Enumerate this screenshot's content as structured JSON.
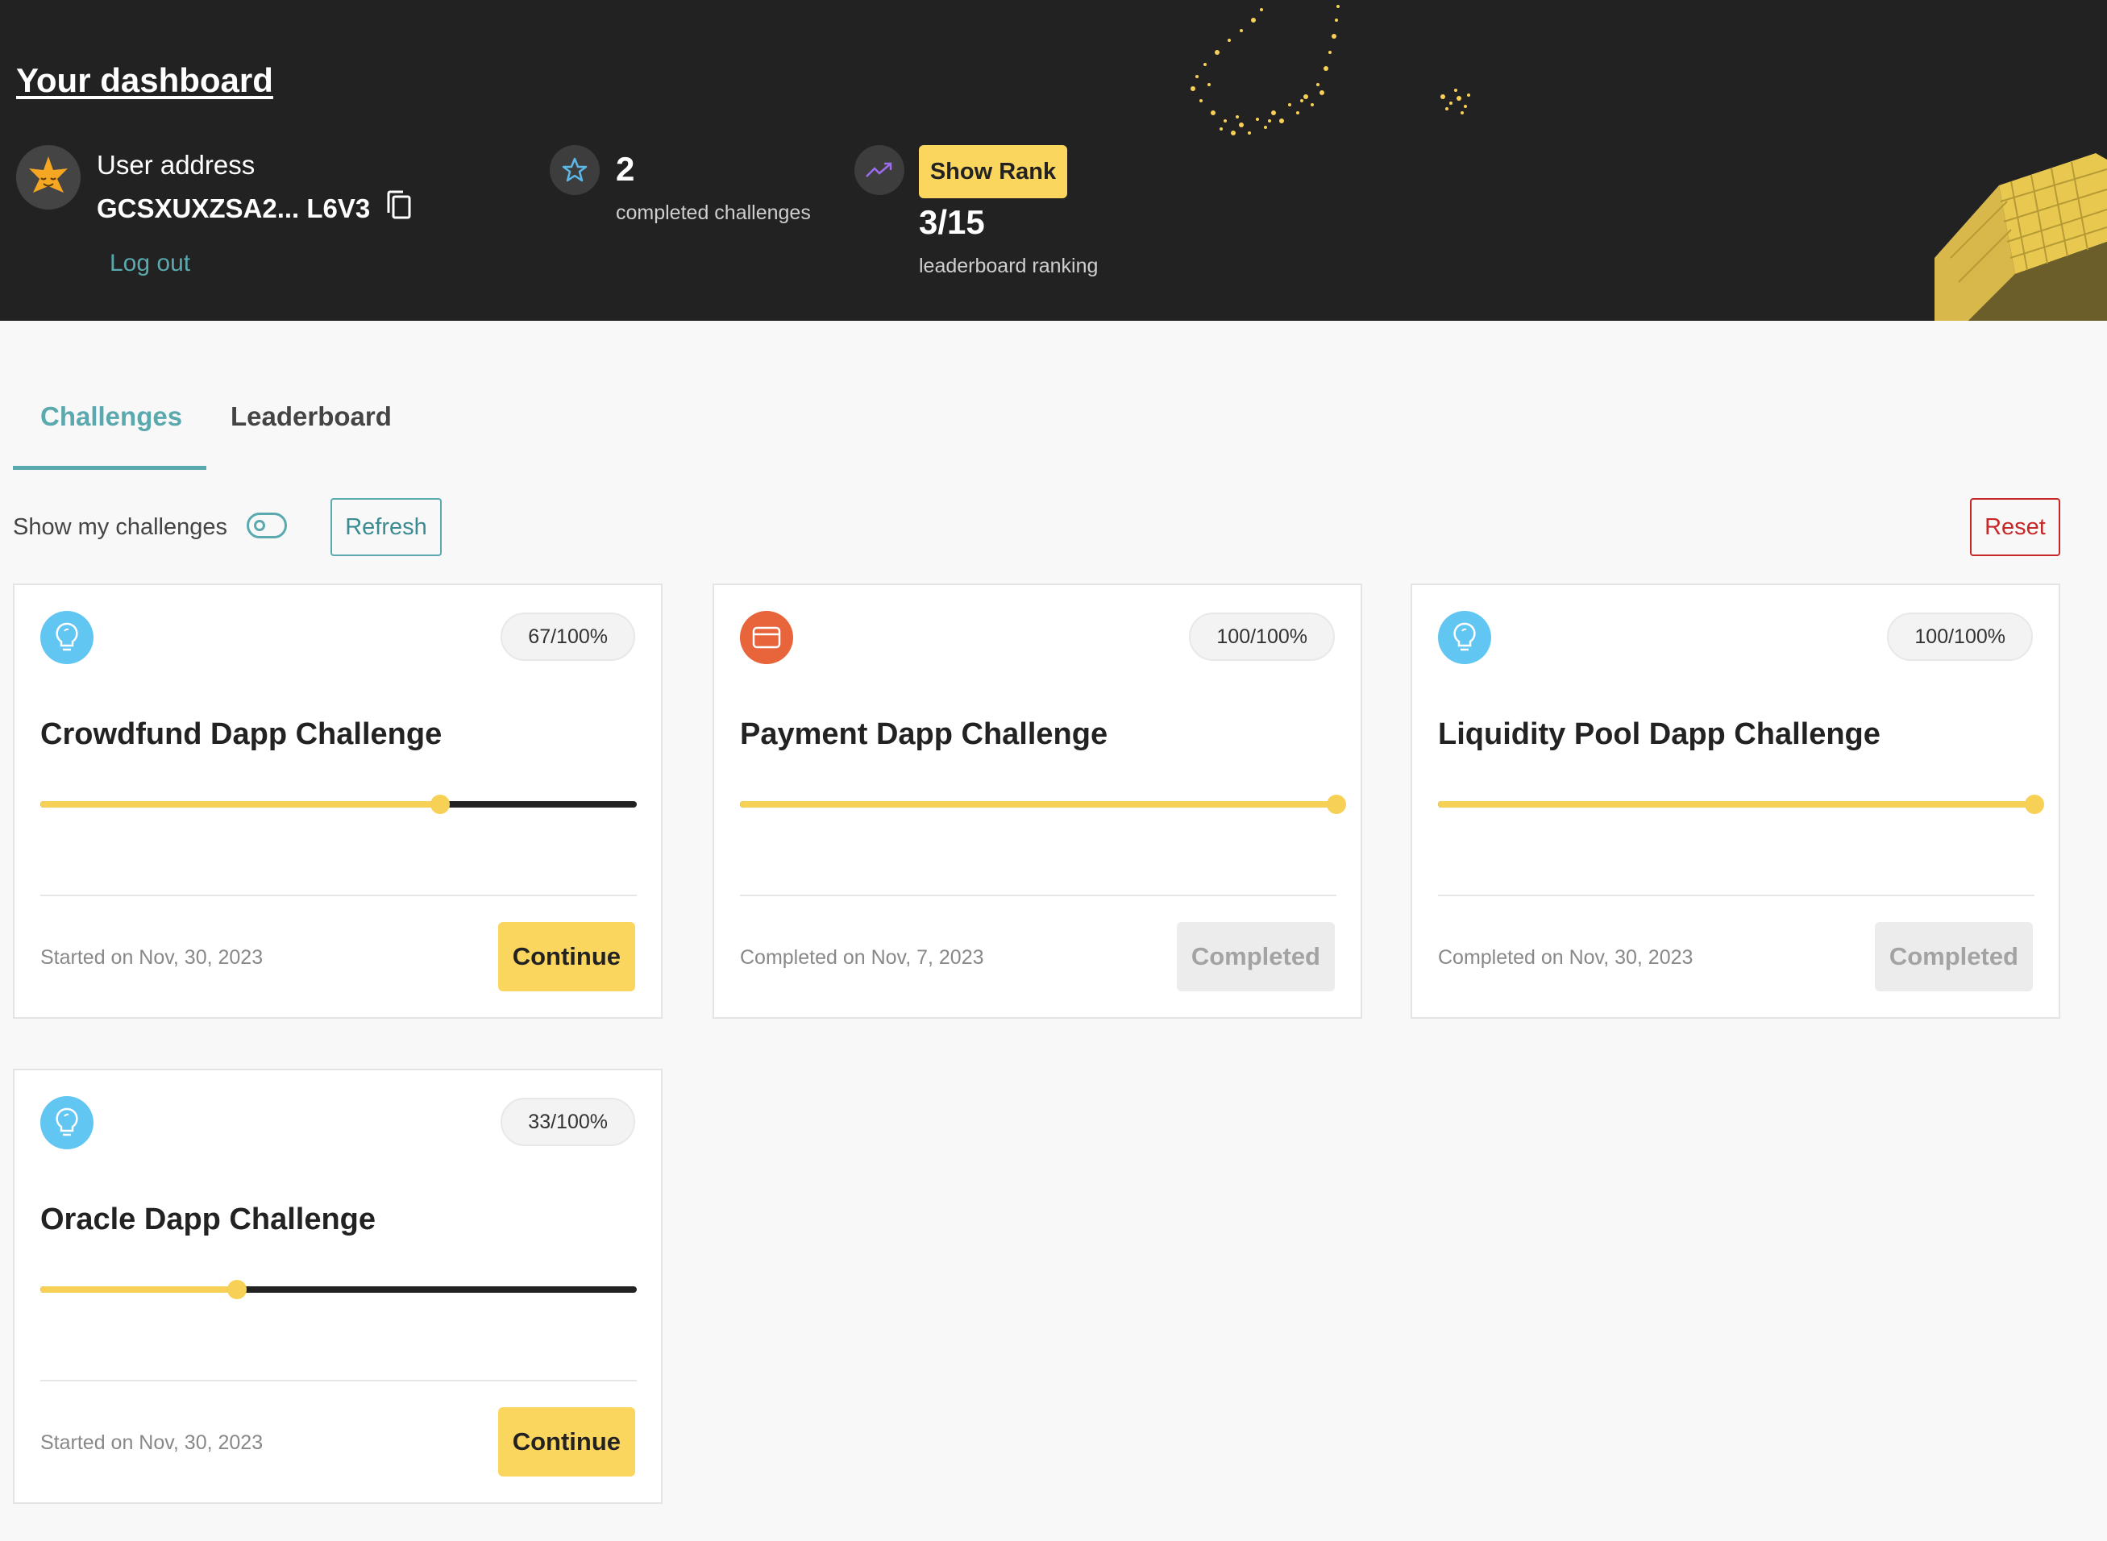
{
  "header": {
    "title": "Your dashboard",
    "user_address_label": "User address",
    "user_address_value": "GCSXUXZSA2...  L6V3",
    "logout_label": "Log out",
    "completed_count": "2",
    "completed_label": "completed challenges",
    "show_rank_label": "Show Rank",
    "rank_value": "3/15",
    "rank_label": "leaderboard ranking"
  },
  "tabs": [
    {
      "label": "Challenges",
      "active": true
    },
    {
      "label": "Leaderboard",
      "active": false
    }
  ],
  "controls": {
    "toggle_label": "Show my challenges",
    "refresh_label": "Refresh",
    "reset_label": "Reset"
  },
  "colors": {
    "accent": "#5aa9ae",
    "yellow": "#fbd65e",
    "danger": "#c62828",
    "header_bg": "#222222"
  },
  "challenges": [
    {
      "title": "Crowdfund Dapp Challenge",
      "progress_label": "67/100%",
      "progress": 0.67,
      "icon": "lightbulb-icon",
      "date": "Started on Nov, 30, 2023",
      "button": "Continue",
      "status": "continue"
    },
    {
      "title": "Payment Dapp Challenge",
      "progress_label": "100/100%",
      "progress": 1.0,
      "icon": "credit-card-icon",
      "date": "Completed on Nov, 7, 2023",
      "button": "Completed",
      "status": "completed"
    },
    {
      "title": "Liquidity Pool Dapp Challenge",
      "progress_label": "100/100%",
      "progress": 1.0,
      "icon": "lightbulb-icon",
      "date": "Completed on Nov, 30, 2023",
      "button": "Completed",
      "status": "completed"
    },
    {
      "title": "Oracle Dapp Challenge",
      "progress_label": "33/100%",
      "progress": 0.33,
      "icon": "lightbulb-icon",
      "date": "Started on Nov, 30, 2023",
      "button": "Continue",
      "status": "continue"
    }
  ]
}
